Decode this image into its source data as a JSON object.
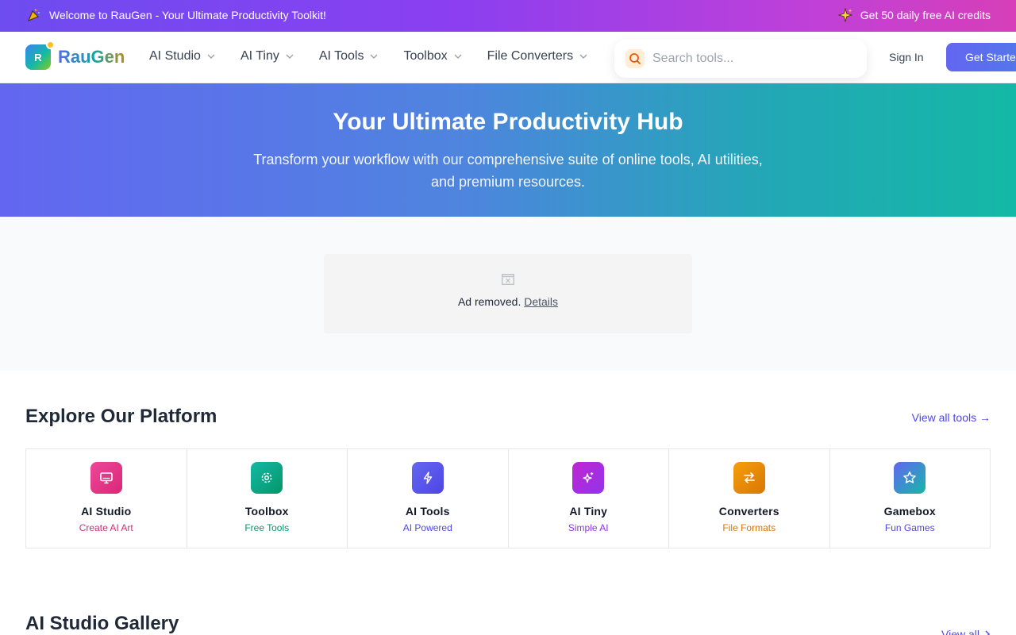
{
  "announcement": {
    "left_text": "Welcome to RauGen - Your Ultimate Productivity Toolkit!",
    "right_text": "Get 50 daily free AI credits",
    "left_icon": "party-popper-icon",
    "right_icon": "sparkles-icon"
  },
  "nav": {
    "logo_letter": "R",
    "logo_text": "RauGen",
    "menu": [
      {
        "label": "AI Studio"
      },
      {
        "label": "AI Tiny"
      },
      {
        "label": "AI Tools"
      },
      {
        "label": "Toolbox"
      },
      {
        "label": "File Converters"
      }
    ],
    "search_placeholder": "Search tools...",
    "sign_in": "Sign In",
    "get_started": "Get Started"
  },
  "hero": {
    "title": "Your Ultimate Productivity Hub",
    "subtitle": "Transform your workflow with our comprehensive suite of online tools, AI utilities, and premium resources."
  },
  "ad": {
    "text": "Ad removed.",
    "link": "Details"
  },
  "explore": {
    "title": "Explore Our Platform",
    "view_all": "View all tools →",
    "cards": [
      {
        "title": "AI Studio",
        "subtitle": "Create AI Art",
        "icon": "monitor-icon",
        "color": "#db2777"
      },
      {
        "title": "Toolbox",
        "subtitle": "Free Tools",
        "icon": "gear-icon",
        "color": "#059669"
      },
      {
        "title": "AI Tools",
        "subtitle": "AI Powered",
        "icon": "lightning-icon",
        "color": "#4f46e5"
      },
      {
        "title": "AI Tiny",
        "subtitle": "Simple AI",
        "icon": "sparkles-icon",
        "color": "#9333ea"
      },
      {
        "title": "Converters",
        "subtitle": "File Formats",
        "icon": "swap-arrows-icon",
        "color": "#d97706"
      },
      {
        "title": "Gamebox",
        "subtitle": "Fun Games",
        "icon": "star-icon",
        "color": "#4f46e5"
      }
    ]
  },
  "gallery": {
    "title": "AI Studio Gallery",
    "view_all": "View all"
  }
}
